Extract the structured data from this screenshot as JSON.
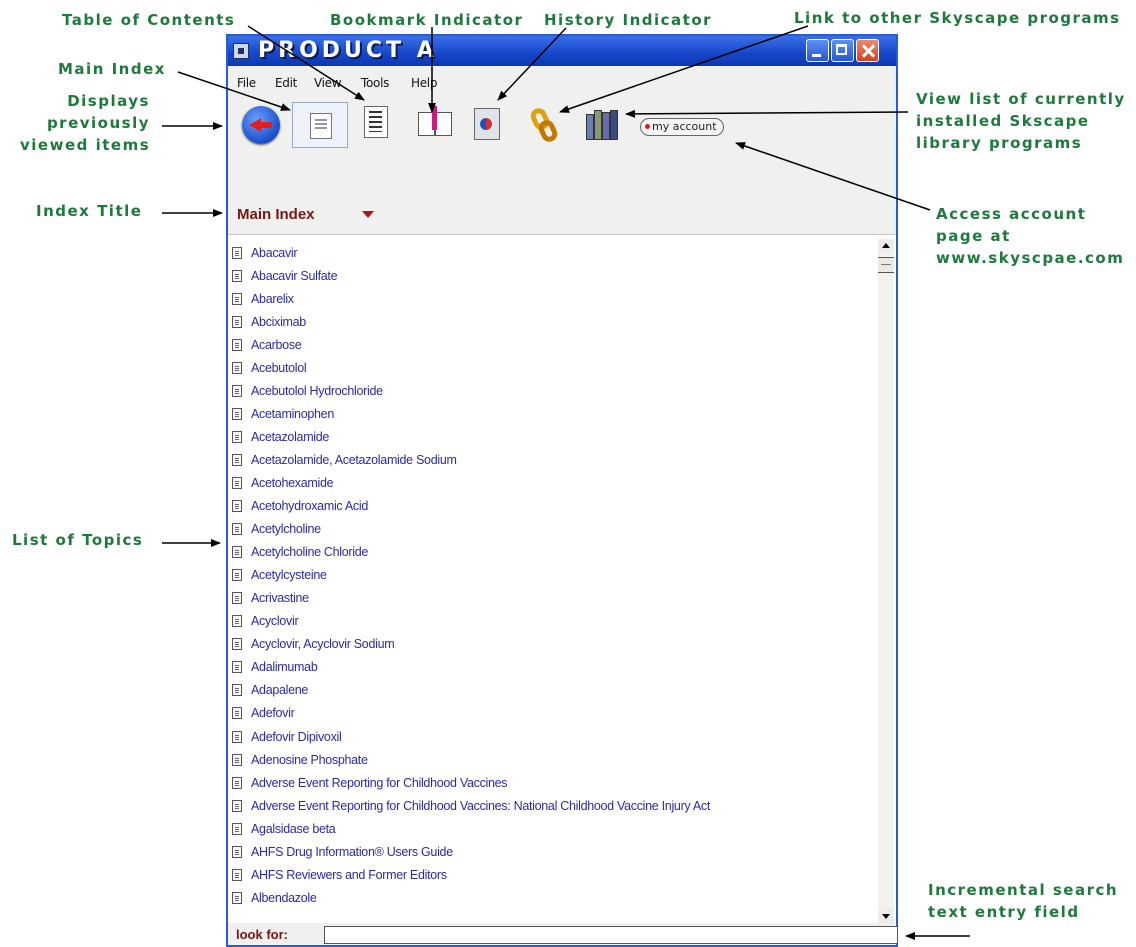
{
  "callouts": {
    "table_of_contents": "Table of Contents",
    "bookmark_indicator": "Bookmark Indicator",
    "history_indicator": "History Indicator",
    "link_programs": "Link to other Skyscape programs",
    "main_index": "Main Index",
    "displays_previous": [
      "Displays",
      "previously",
      "viewed items"
    ],
    "view_list": [
      "View list of currently",
      "installed Skscape",
      "library programs"
    ],
    "index_title": "Index Title",
    "access_account": [
      "Access account",
      "page at",
      "www.skyscpae.com"
    ],
    "list_of_topics": "List of Topics",
    "incremental_search": [
      "Incremental search",
      "text entry field"
    ]
  },
  "window": {
    "title": "PRODUCT A"
  },
  "menu": [
    "File",
    "Edit",
    "View",
    "Tools",
    "Help"
  ],
  "toolbar": {
    "icons": [
      "back-arrow-icon",
      "table-of-contents-icon",
      "main-index-icon",
      "bookmark-icon",
      "history-icon",
      "link-icon",
      "library-icon"
    ],
    "account_label": "my account"
  },
  "index": {
    "title": "Main Index"
  },
  "topics": [
    "Abacavir",
    "Abacavir Sulfate",
    "Abarelix",
    "Abciximab",
    "Acarbose",
    "Acebutolol",
    "Acebutolol Hydrochloride",
    "Acetaminophen",
    "Acetazolamide",
    "Acetazolamide, Acetazolamide Sodium",
    "Acetohexamide",
    "Acetohydroxamic Acid",
    "Acetylcholine",
    "Acetylcholine Chloride",
    "Acetylcysteine",
    "Acrivastine",
    "Acyclovir",
    "Acyclovir, Acyclovir Sodium",
    "Adalimumab",
    "Adapalene",
    "Adefovir",
    "Adefovir Dipivoxil",
    "Adenosine Phosphate",
    "Adverse Event Reporting for Childhood Vaccines",
    "Adverse Event Reporting for Childhood Vaccines: National Childhood Vaccine Injury Act",
    "Agalsidase beta",
    "AHFS Drug Information® Users Guide",
    "AHFS Reviewers and Former Editors",
    "Albendazole"
  ],
  "search": {
    "label": "look for:",
    "value": ""
  },
  "colors": {
    "callout": "#1e7a3a",
    "titlebar": "#1646c8",
    "index_title": "#7a1515",
    "topic_link": "#2a2aa8"
  }
}
